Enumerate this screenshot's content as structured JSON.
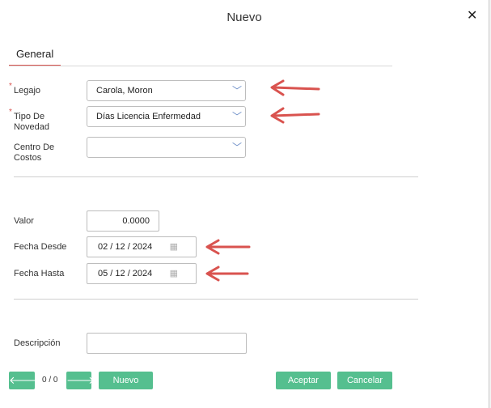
{
  "dialog": {
    "title": "Nuevo",
    "close_icon": "close-icon"
  },
  "tabs": [
    {
      "label": "General"
    }
  ],
  "form": {
    "legajo": {
      "label": "Legajo",
      "value": "Carola, Moron",
      "required": true
    },
    "tipo_novedad": {
      "label": "Tipo De\nNovedad",
      "value": "Días Licencia Enfermedad",
      "required": true
    },
    "centro_costos": {
      "label": "Centro De\nCostos",
      "value": ""
    },
    "valor": {
      "label": "Valor",
      "value": "0.0000"
    },
    "fecha_desde": {
      "label": "Fecha Desde",
      "value": "02 / 12 / 2024"
    },
    "fecha_hasta": {
      "label": "Fecha Hasta",
      "value": "05 / 12 / 2024"
    },
    "descripcion": {
      "label": "Descripción",
      "value": ""
    }
  },
  "footer": {
    "counter": "0 / 0",
    "nuevo_label": "Nuevo",
    "aceptar_label": "Aceptar",
    "cancelar_label": "Cancelar"
  },
  "colors": {
    "accent": "#55bf8f",
    "required": "#d9534f",
    "annotation_arrow": "#d9534f"
  }
}
